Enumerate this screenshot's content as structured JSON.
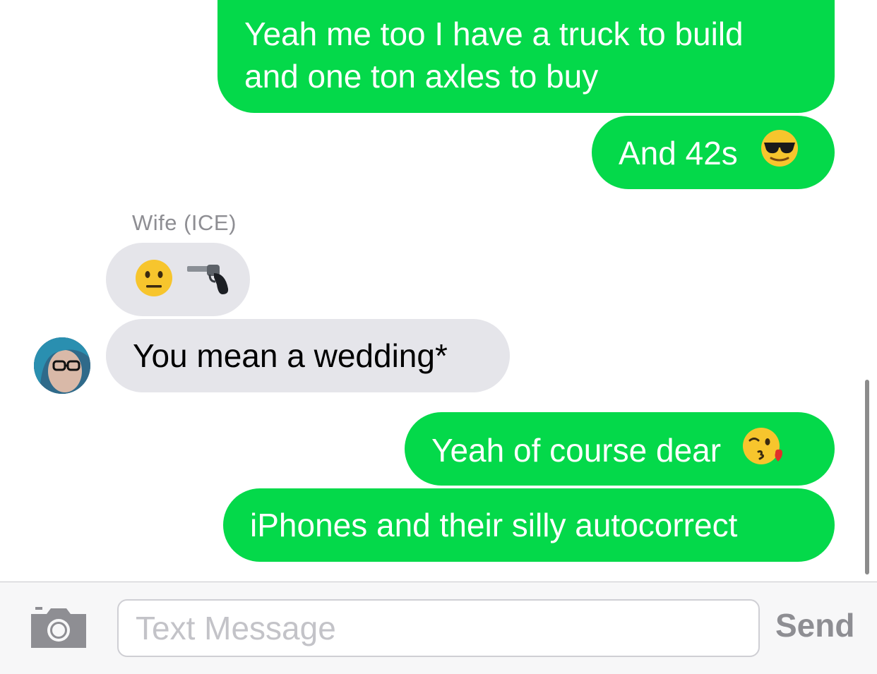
{
  "messages": [
    {
      "direction": "sent",
      "text": "Yeah me too I have a truck to build\nand one ton axles to buy"
    },
    {
      "direction": "sent",
      "text": "And 42s",
      "emoji": "sunglasses-emoji"
    },
    {
      "direction": "received",
      "sender": "Wife (ICE)",
      "emoji": "neutral-face-and-pistol-emoji"
    },
    {
      "direction": "received",
      "text": "You mean a wedding*"
    },
    {
      "direction": "sent",
      "text": "Yeah of course dear",
      "emoji": "kiss-emoji"
    },
    {
      "direction": "sent",
      "text": "iPhones and their silly autocorrect"
    }
  ],
  "input": {
    "placeholder": "Text Message",
    "value": "",
    "send_label": "Send",
    "camera_icon": "camera-icon"
  },
  "colors": {
    "sent_bubble": "#04d94a",
    "received_bubble": "#e5e5ea",
    "sender_label": "#8e8e93"
  }
}
